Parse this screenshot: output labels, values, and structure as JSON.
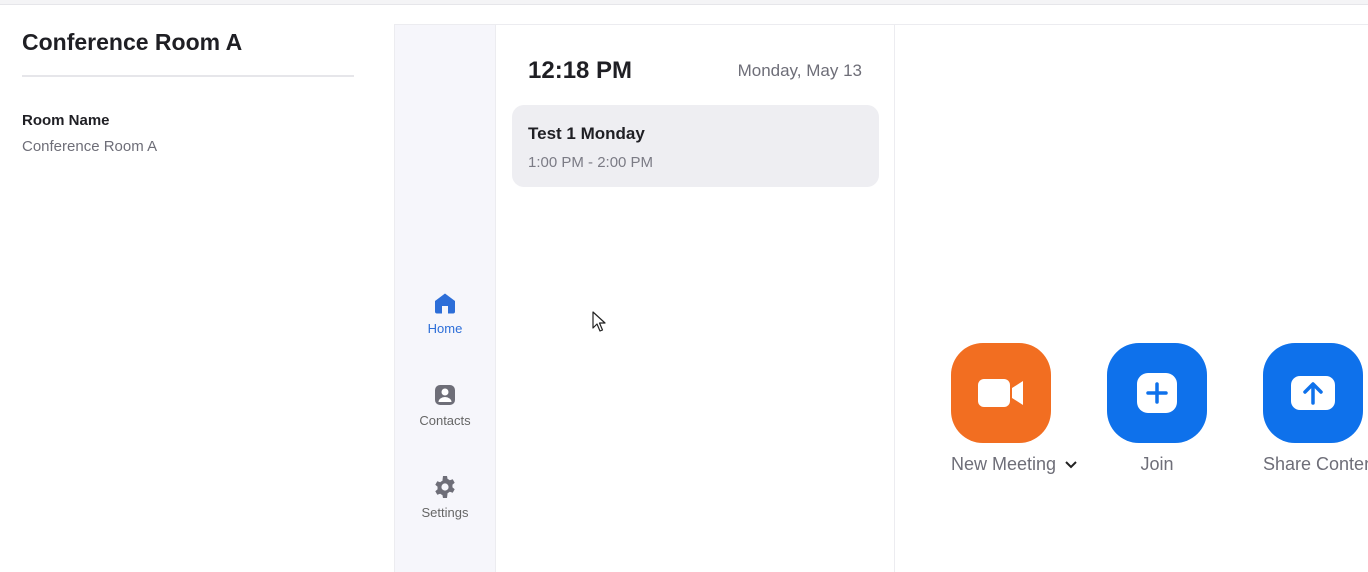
{
  "info": {
    "title": "Conference Room A",
    "room_name_label": "Room Name",
    "room_name_value": "Conference Room A"
  },
  "nav": {
    "items": [
      {
        "label": "Home",
        "icon": "home-icon",
        "active": true
      },
      {
        "label": "Contacts",
        "icon": "contacts-icon",
        "active": false
      },
      {
        "label": "Settings",
        "icon": "gear-icon",
        "active": false
      }
    ]
  },
  "schedule": {
    "time": "12:18 PM",
    "date": "Monday, May 13",
    "meetings": [
      {
        "title": "Test 1 Monday",
        "time": "1:00 PM - 2:00 PM"
      }
    ]
  },
  "actions": [
    {
      "label": "New Meeting",
      "icon": "video-camera-icon",
      "color": "#f26e21",
      "has_dropdown": true
    },
    {
      "label": "Join",
      "icon": "plus-icon",
      "color": "#0e71eb"
    },
    {
      "label": "Share Content",
      "icon": "upload-arrow-icon",
      "color": "#0e71eb"
    }
  ],
  "colors": {
    "accent_blue": "#0e71eb",
    "accent_orange": "#f26e21",
    "nav_active": "#2d6ed8"
  }
}
